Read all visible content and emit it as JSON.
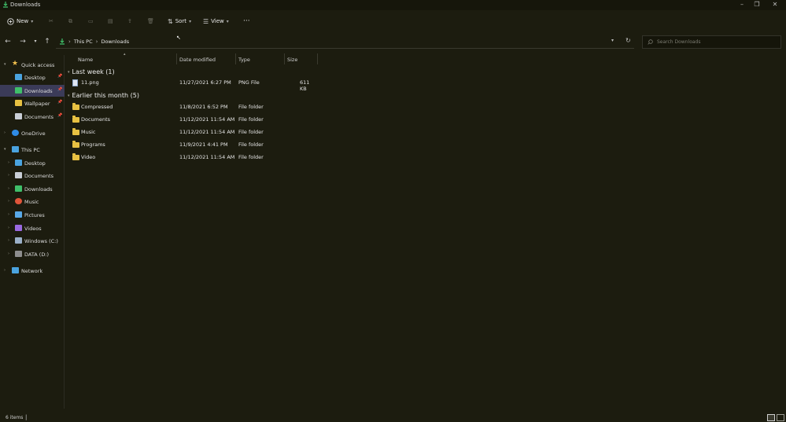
{
  "window": {
    "title": "Downloads"
  },
  "toolbar": {
    "new_label": "New",
    "sort_label": "Sort",
    "view_label": "View",
    "more_label": "···"
  },
  "address": {
    "crumbs": [
      "This PC",
      "Downloads"
    ],
    "separator": "›"
  },
  "search": {
    "placeholder": "Search Downloads"
  },
  "sidebar": {
    "items": [
      {
        "label": "Quick access",
        "icon": "star-icon",
        "color": "#f2c14e"
      },
      {
        "label": "Desktop",
        "icon": "desktop-icon",
        "color": "#4aa3df"
      },
      {
        "label": "Downloads",
        "icon": "download-icon",
        "color": "#3fbf6a"
      },
      {
        "label": "Wallpaper",
        "icon": "folder-icon",
        "color": "#e8c142"
      },
      {
        "label": "Documents",
        "icon": "documents-icon",
        "color": "#c9ced6"
      },
      {
        "label": "OneDrive",
        "icon": "cloud-icon",
        "color": "#2f8be6"
      },
      {
        "label": "This PC",
        "icon": "computer-icon",
        "color": "#4aa3df"
      },
      {
        "label": "Desktop",
        "icon": "desktop-icon",
        "color": "#4aa3df"
      },
      {
        "label": "Documents",
        "icon": "documents-icon",
        "color": "#c9ced6"
      },
      {
        "label": "Downloads",
        "icon": "download-icon",
        "color": "#3fbf6a"
      },
      {
        "label": "Music",
        "icon": "music-icon",
        "color": "#e0553a"
      },
      {
        "label": "Pictures",
        "icon": "pictures-icon",
        "color": "#59a9e8"
      },
      {
        "label": "Videos",
        "icon": "videos-icon",
        "color": "#9a6ae0"
      },
      {
        "label": "Windows (C:)",
        "icon": "drive-icon",
        "color": "#9bb0c8"
      },
      {
        "label": "DATA (D:)",
        "icon": "drive-icon",
        "color": "#8e8e8e"
      },
      {
        "label": "Network",
        "icon": "network-icon",
        "color": "#4aa3df"
      }
    ]
  },
  "columns": {
    "name": "Name",
    "date": "Date modified",
    "type": "Type",
    "size": "Size"
  },
  "groups": [
    {
      "title": "Last week (1)",
      "rows": [
        {
          "name": "11.png",
          "date": "11/27/2021 6:27 PM",
          "type": "PNG File",
          "size": "611 KB"
        }
      ]
    },
    {
      "title": "Earlier this month (5)",
      "rows": [
        {
          "name": "Compressed",
          "date": "11/8/2021 6:52 PM",
          "type": "File folder",
          "size": ""
        },
        {
          "name": "Documents",
          "date": "11/12/2021 11:54 AM",
          "type": "File folder",
          "size": ""
        },
        {
          "name": "Music",
          "date": "11/12/2021 11:54 AM",
          "type": "File folder",
          "size": ""
        },
        {
          "name": "Programs",
          "date": "11/9/2021 4:41 PM",
          "type": "File folder",
          "size": ""
        },
        {
          "name": "Video",
          "date": "11/12/2021 11:54 AM",
          "type": "File folder",
          "size": ""
        }
      ]
    }
  ],
  "status": {
    "count": "6 items"
  }
}
